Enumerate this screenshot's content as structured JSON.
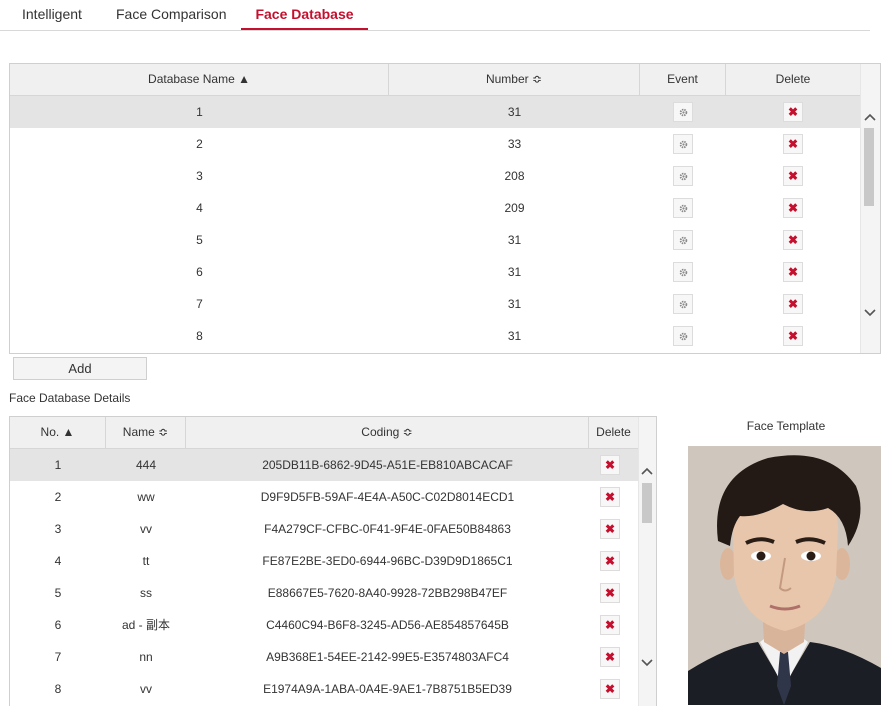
{
  "tabs": [
    "Intelligent",
    "Face Comparison",
    "Face Database"
  ],
  "active_tab": "Face Database",
  "colors": {
    "accent": "#c4102e",
    "header_bg": "#f0f0f0",
    "selected_row": "#e4e4e4"
  },
  "database_table": {
    "headers": {
      "name": "Database Name ▲",
      "number": "Number ≎",
      "event": "Event",
      "delete": "Delete"
    },
    "rows": [
      {
        "name": "1",
        "number": "31"
      },
      {
        "name": "2",
        "number": "33"
      },
      {
        "name": "3",
        "number": "208"
      },
      {
        "name": "4",
        "number": "209"
      },
      {
        "name": "5",
        "number": "31"
      },
      {
        "name": "6",
        "number": "31"
      },
      {
        "name": "7",
        "number": "31"
      },
      {
        "name": "8",
        "number": "31"
      }
    ],
    "selected_index": 0,
    "event_icon": "gear-icon",
    "delete_icon": "x-icon"
  },
  "add_button": "Add",
  "details_title": "Face Database Details",
  "details_table": {
    "headers": {
      "no": "No. ▲",
      "name": "Name ≎",
      "coding": "Coding ≎",
      "delete": "Delete"
    },
    "rows": [
      {
        "no": "1",
        "name": "444",
        "coding": "205DB11B-6862-9D45-A51E-EB810ABCACAF"
      },
      {
        "no": "2",
        "name": "ww",
        "coding": "D9F9D5FB-59AF-4E4A-A50C-C02D8014ECD1"
      },
      {
        "no": "3",
        "name": "vv",
        "coding": "F4A279CF-CFBC-0F41-9F4E-0FAE50B84863"
      },
      {
        "no": "4",
        "name": "tt",
        "coding": "FE87E2BE-3ED0-6944-96BC-D39D9D1865C1"
      },
      {
        "no": "5",
        "name": "ss",
        "coding": "E88667E5-7620-8A40-9928-72BB298B47EF"
      },
      {
        "no": "6",
        "name": "ad - 副本",
        "coding": "C4460C94-B6F8-3245-AD56-AE854857645B"
      },
      {
        "no": "7",
        "name": "nn",
        "coding": "A9B368E1-54EE-2142-99E5-E3574803AFC4"
      },
      {
        "no": "8",
        "name": "vv",
        "coding": "E1974A9A-1ABA-0A4E-9AE1-7B8751B5ED39"
      }
    ],
    "selected_index": 0
  },
  "face_template_label": "Face Template",
  "face_template_image": "face-portrait"
}
